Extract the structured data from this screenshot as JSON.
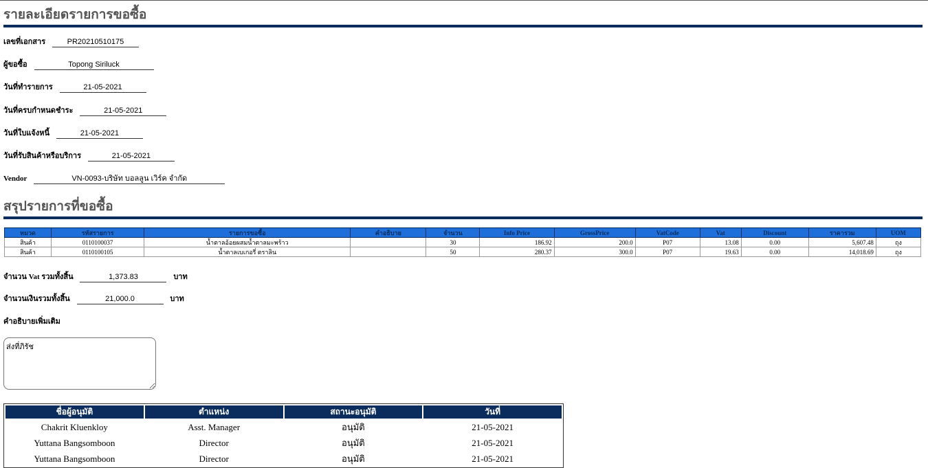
{
  "header": {
    "title": "รายละเอียดรายการขอซื้อ"
  },
  "details": [
    {
      "label": "เลขที่เอกสาร",
      "value": "PR20210510175"
    },
    {
      "label": "ผู้ขอซื้อ",
      "value": "Topong Siriluck"
    },
    {
      "label": "วันที่ทำรายการ",
      "value": "21-05-2021"
    },
    {
      "label": "วันที่ครบกำหนดชำระ",
      "value": "21-05-2021"
    },
    {
      "label": "วันที่ใบแจ้งหนี้",
      "value": "21-05-2021"
    },
    {
      "label": "วันที่รับสินค้าหรือบริการ",
      "value": "21-05-2021"
    },
    {
      "label": "Vendor",
      "value": "VN-0093-บริษัท บอลลูน เวิร์ค จำกัด"
    }
  ],
  "summary": {
    "title": "สรุปรายการที่ขอซื้อ",
    "columns": [
      "หมวด",
      "รหัสรายการ",
      "รายการขอซื้อ",
      "คำอธิบาย",
      "จำนวน",
      "Info Price",
      "GrossPrice",
      "VatCode",
      "Vat",
      "Discount",
      "ราคารวม",
      "UOM"
    ],
    "rows": [
      [
        "สินค้า",
        "0110100037",
        "น้ำตาลอ้อยผสมน้ำตาลมะพร้าว",
        "",
        "30",
        "186.92",
        "200.0",
        "P07",
        "13.08",
        "0.00",
        "5,607.48",
        "ถุง"
      ],
      [
        "สินค้า",
        "0110100105",
        "น้ำตาลเบเกอรี่ ตราลิน",
        "",
        "50",
        "280.37",
        "300.0",
        "P07",
        "19.63",
        "0.00",
        "14,018.69",
        "ถุง"
      ]
    ]
  },
  "totals": {
    "vat_label": "จำนวน Vat รวมทั้งสิ้น",
    "vat_value": "1,373.83",
    "amount_label": "จำนวนเงินรวมทั้งสิ้น",
    "amount_value": "21,000.0",
    "unit": "บาท"
  },
  "remarks": {
    "label": "คำอธิบายเพิ่มเติม",
    "value": "ส่งที่ภิรัช"
  },
  "approvals": {
    "columns": [
      "ชื่อผู้อนุมัติ",
      "ตำแหน่ง",
      "สถานะอนุมัติ",
      "วันที่"
    ],
    "rows": [
      [
        "Chakrit Kluenkloy",
        "Asst. Manager",
        "อนุมัติ",
        "21-05-2021"
      ],
      [
        "Yuttana Bangsomboon",
        "Director",
        "อนุมัติ",
        "21-05-2021"
      ],
      [
        "Yuttana Bangsomboon",
        "Director",
        "อนุมัติ",
        "21-05-2021"
      ]
    ]
  },
  "colors": {
    "heading_rule": "#0b2d5e",
    "table_header": "#1e6fd9",
    "approval_header": "#0b2d5e"
  }
}
